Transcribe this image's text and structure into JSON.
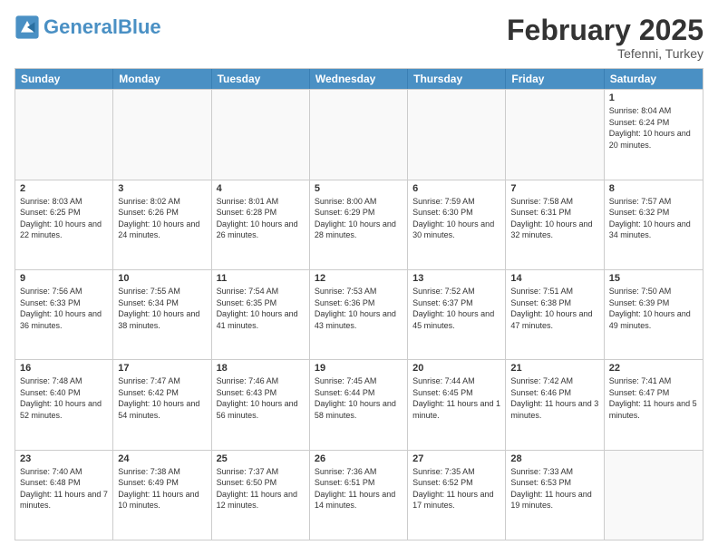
{
  "header": {
    "logo_general": "General",
    "logo_blue": "Blue",
    "month_title": "February 2025",
    "location": "Tefenni, Turkey"
  },
  "days_of_week": [
    "Sunday",
    "Monday",
    "Tuesday",
    "Wednesday",
    "Thursday",
    "Friday",
    "Saturday"
  ],
  "weeks": [
    [
      {
        "day": "",
        "info": ""
      },
      {
        "day": "",
        "info": ""
      },
      {
        "day": "",
        "info": ""
      },
      {
        "day": "",
        "info": ""
      },
      {
        "day": "",
        "info": ""
      },
      {
        "day": "",
        "info": ""
      },
      {
        "day": "1",
        "info": "Sunrise: 8:04 AM\nSunset: 6:24 PM\nDaylight: 10 hours and 20 minutes."
      }
    ],
    [
      {
        "day": "2",
        "info": "Sunrise: 8:03 AM\nSunset: 6:25 PM\nDaylight: 10 hours and 22 minutes."
      },
      {
        "day": "3",
        "info": "Sunrise: 8:02 AM\nSunset: 6:26 PM\nDaylight: 10 hours and 24 minutes."
      },
      {
        "day": "4",
        "info": "Sunrise: 8:01 AM\nSunset: 6:28 PM\nDaylight: 10 hours and 26 minutes."
      },
      {
        "day": "5",
        "info": "Sunrise: 8:00 AM\nSunset: 6:29 PM\nDaylight: 10 hours and 28 minutes."
      },
      {
        "day": "6",
        "info": "Sunrise: 7:59 AM\nSunset: 6:30 PM\nDaylight: 10 hours and 30 minutes."
      },
      {
        "day": "7",
        "info": "Sunrise: 7:58 AM\nSunset: 6:31 PM\nDaylight: 10 hours and 32 minutes."
      },
      {
        "day": "8",
        "info": "Sunrise: 7:57 AM\nSunset: 6:32 PM\nDaylight: 10 hours and 34 minutes."
      }
    ],
    [
      {
        "day": "9",
        "info": "Sunrise: 7:56 AM\nSunset: 6:33 PM\nDaylight: 10 hours and 36 minutes."
      },
      {
        "day": "10",
        "info": "Sunrise: 7:55 AM\nSunset: 6:34 PM\nDaylight: 10 hours and 38 minutes."
      },
      {
        "day": "11",
        "info": "Sunrise: 7:54 AM\nSunset: 6:35 PM\nDaylight: 10 hours and 41 minutes."
      },
      {
        "day": "12",
        "info": "Sunrise: 7:53 AM\nSunset: 6:36 PM\nDaylight: 10 hours and 43 minutes."
      },
      {
        "day": "13",
        "info": "Sunrise: 7:52 AM\nSunset: 6:37 PM\nDaylight: 10 hours and 45 minutes."
      },
      {
        "day": "14",
        "info": "Sunrise: 7:51 AM\nSunset: 6:38 PM\nDaylight: 10 hours and 47 minutes."
      },
      {
        "day": "15",
        "info": "Sunrise: 7:50 AM\nSunset: 6:39 PM\nDaylight: 10 hours and 49 minutes."
      }
    ],
    [
      {
        "day": "16",
        "info": "Sunrise: 7:48 AM\nSunset: 6:40 PM\nDaylight: 10 hours and 52 minutes."
      },
      {
        "day": "17",
        "info": "Sunrise: 7:47 AM\nSunset: 6:42 PM\nDaylight: 10 hours and 54 minutes."
      },
      {
        "day": "18",
        "info": "Sunrise: 7:46 AM\nSunset: 6:43 PM\nDaylight: 10 hours and 56 minutes."
      },
      {
        "day": "19",
        "info": "Sunrise: 7:45 AM\nSunset: 6:44 PM\nDaylight: 10 hours and 58 minutes."
      },
      {
        "day": "20",
        "info": "Sunrise: 7:44 AM\nSunset: 6:45 PM\nDaylight: 11 hours and 1 minute."
      },
      {
        "day": "21",
        "info": "Sunrise: 7:42 AM\nSunset: 6:46 PM\nDaylight: 11 hours and 3 minutes."
      },
      {
        "day": "22",
        "info": "Sunrise: 7:41 AM\nSunset: 6:47 PM\nDaylight: 11 hours and 5 minutes."
      }
    ],
    [
      {
        "day": "23",
        "info": "Sunrise: 7:40 AM\nSunset: 6:48 PM\nDaylight: 11 hours and 7 minutes."
      },
      {
        "day": "24",
        "info": "Sunrise: 7:38 AM\nSunset: 6:49 PM\nDaylight: 11 hours and 10 minutes."
      },
      {
        "day": "25",
        "info": "Sunrise: 7:37 AM\nSunset: 6:50 PM\nDaylight: 11 hours and 12 minutes."
      },
      {
        "day": "26",
        "info": "Sunrise: 7:36 AM\nSunset: 6:51 PM\nDaylight: 11 hours and 14 minutes."
      },
      {
        "day": "27",
        "info": "Sunrise: 7:35 AM\nSunset: 6:52 PM\nDaylight: 11 hours and 17 minutes."
      },
      {
        "day": "28",
        "info": "Sunrise: 7:33 AM\nSunset: 6:53 PM\nDaylight: 11 hours and 19 minutes."
      },
      {
        "day": "",
        "info": ""
      }
    ]
  ]
}
